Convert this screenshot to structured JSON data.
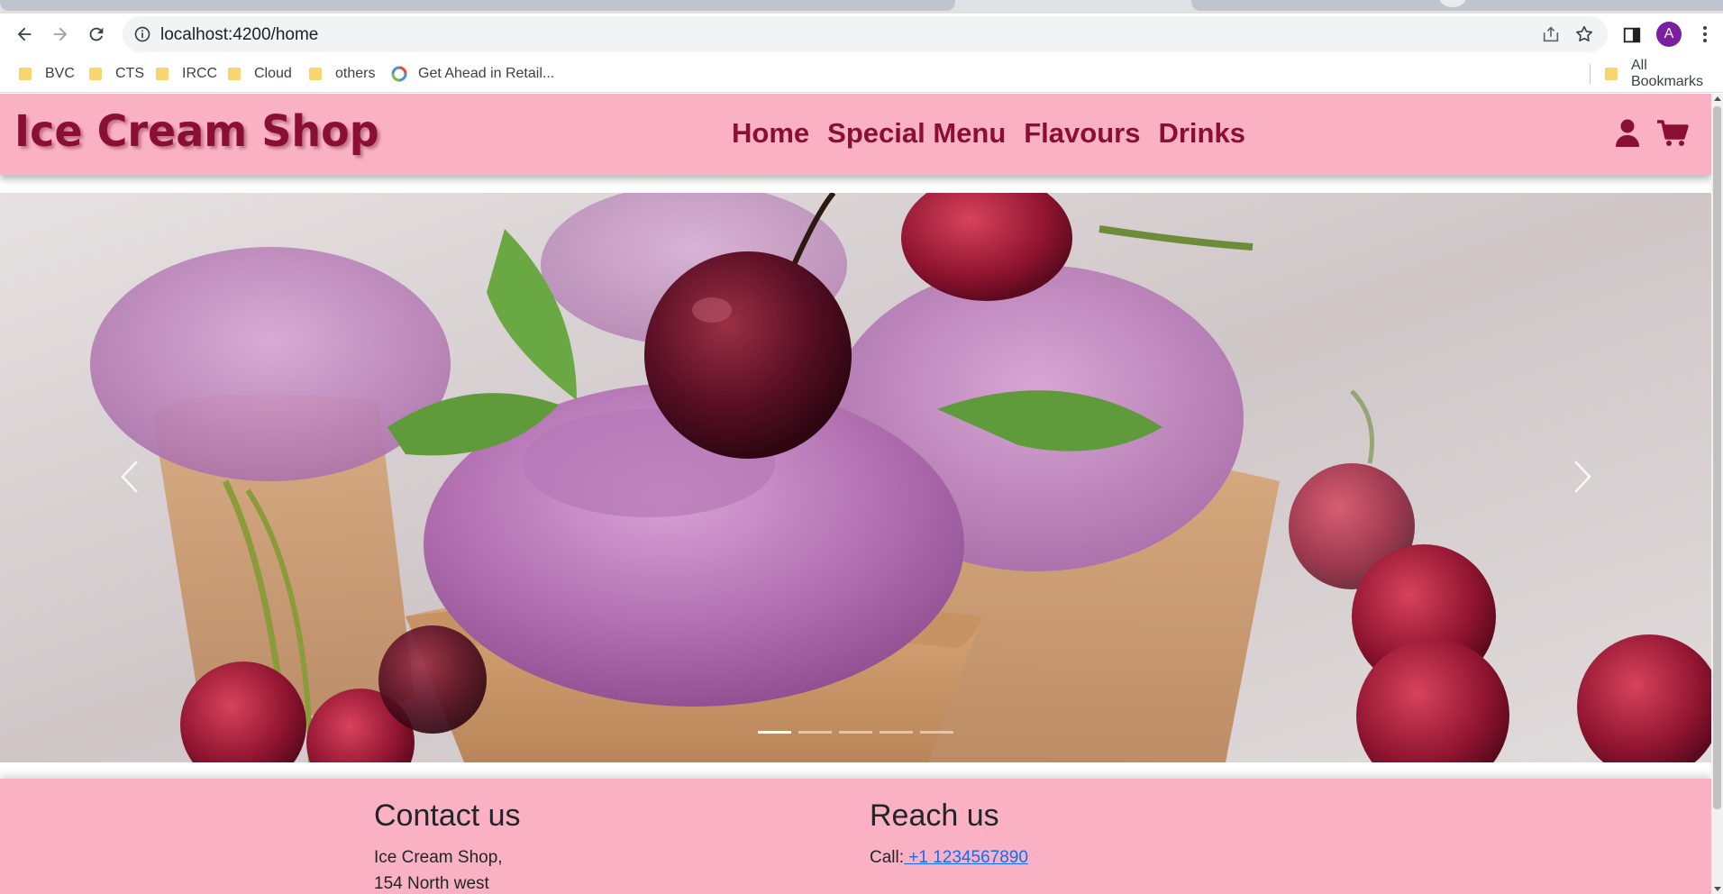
{
  "browser": {
    "url": "localhost:4200/home",
    "avatar_letter": "A",
    "bookmarks": [
      {
        "label": "BVC",
        "icon": "folder-icon"
      },
      {
        "label": "CTS",
        "icon": "folder-icon"
      },
      {
        "label": "IRCC",
        "icon": "folder-icon"
      },
      {
        "label": "Cloud",
        "icon": "folder-icon"
      },
      {
        "label": "others",
        "icon": "folder-icon"
      },
      {
        "label": "Get Ahead in Retail...",
        "icon": "retail-icon"
      }
    ],
    "all_bookmarks_label": "All Bookmarks"
  },
  "header": {
    "brand": "Ice Cream Shop",
    "nav": [
      "Home",
      "Special Menu",
      "Flavours",
      "Drinks"
    ],
    "icons": [
      "user-icon",
      "cart-icon"
    ]
  },
  "carousel": {
    "slide_count": 5,
    "active_index": 0,
    "prev_icon": "chevron-left-icon",
    "next_icon": "chevron-right-icon"
  },
  "footer": {
    "contact_title": "Contact us",
    "address_line1": "Ice Cream Shop,",
    "address_line2": "154 North west",
    "reach_title": "Reach us",
    "call_label": "Call:",
    "phone": " +1 1234567890"
  },
  "colors": {
    "header_bg": "#fbb1c4",
    "brand_text": "#8a0f35",
    "link": "#0d6efd"
  }
}
